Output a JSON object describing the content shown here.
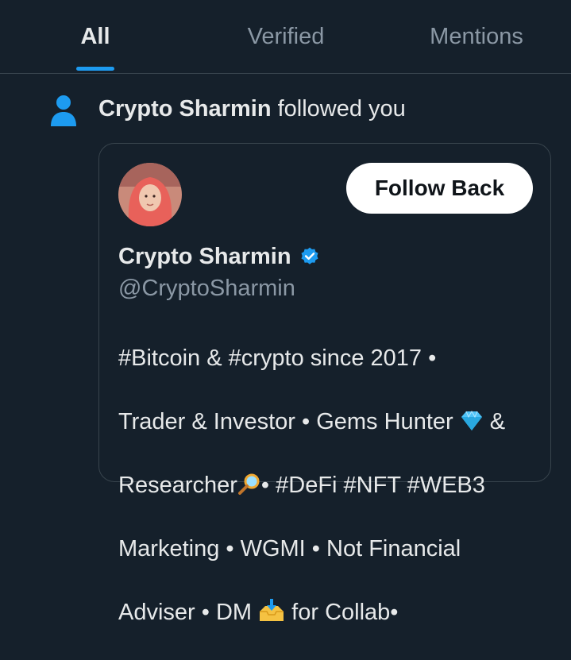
{
  "tabs": [
    {
      "label": "All",
      "active": true
    },
    {
      "label": "Verified",
      "active": false
    },
    {
      "label": "Mentions",
      "active": false
    }
  ],
  "notification": {
    "actor_name": "Crypto Sharmin",
    "action_text": "followed you"
  },
  "profile_card": {
    "display_name": "Crypto Sharmin",
    "handle": "@CryptoSharmin",
    "verified": true,
    "follow_button_label": "Follow Back",
    "bio_line1": "#Bitcoin & #crypto since 2017 •",
    "bio_line2a": "Trader & Investor • Gems Hunter ",
    "bio_line2b": " &",
    "bio_line3a": "Researcher",
    "bio_line3b": "• #DeFi #NFT #WEB3",
    "bio_line4": "Marketing • WGMI • Not Financial",
    "bio_line5a": "Adviser • DM ",
    "bio_line5b": " for Collab•"
  },
  "colors": {
    "background": "#15202b",
    "accent": "#1d9bf0",
    "muted_text": "#8b98a5",
    "primary_text": "#e7e9ea"
  },
  "icons": [
    "person-icon",
    "verified-badge-icon",
    "gem-emoji-icon",
    "magnifier-emoji-icon",
    "inbox-tray-emoji-icon"
  ]
}
